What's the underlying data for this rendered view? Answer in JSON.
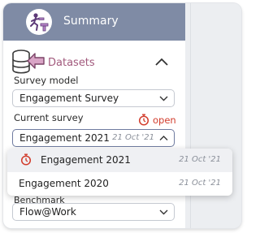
{
  "header": {
    "title": "Summary"
  },
  "datasets": {
    "label": "Datasets"
  },
  "survey_model": {
    "label": "Survey model",
    "value": "Engagement Survey"
  },
  "current_survey": {
    "label": "Current survey",
    "status": "open",
    "value": "Engagement 2021",
    "date": "21 Oct '21"
  },
  "dropdown": {
    "options": [
      {
        "name": "Engagement 2021",
        "date": "21 Oct '21"
      },
      {
        "name": "Engagement 2020",
        "date": "21 Oct '21"
      }
    ]
  },
  "benchmark": {
    "label": "Benchmark",
    "value": "Flow@Work"
  },
  "colors": {
    "header_bg": "#7f8ba5",
    "accent": "#a25a7d",
    "status_open": "#d23c2c"
  },
  "icons": {
    "summary": "person-hurdles-icon",
    "datasets": "database-arrow-icon",
    "collapse": "chevron-up-icon",
    "status": "stopwatch-icon",
    "select": "chevron-down-icon"
  }
}
